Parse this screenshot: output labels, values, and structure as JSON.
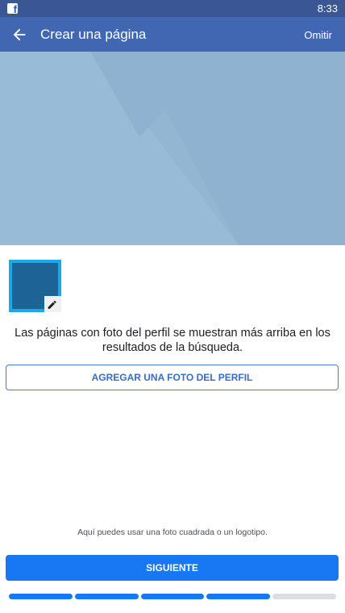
{
  "status_bar": {
    "app_icon": "facebook-icon",
    "time": "8:33"
  },
  "app_bar": {
    "back_icon": "arrow-left-icon",
    "title": "Crear una página",
    "skip_label": "Omitir"
  },
  "cover": {
    "background_color": "#93b6d3"
  },
  "profile": {
    "edit_icon": "pencil-icon",
    "info_text": "Las páginas con foto del perfil se muestran más arriba en los resultados de la búsqueda.",
    "add_photo_label": "AGREGAR UNA FOTO DEL PERFIL"
  },
  "footer": {
    "hint": "Aquí puedes usar una foto cuadrada o un logotipo.",
    "next_label": "SIGUIENTE"
  },
  "progress": {
    "total_steps": 5,
    "completed_steps": 4,
    "active_color": "#1877f2",
    "inactive_color": "#dadde1"
  },
  "colors": {
    "status_bar": "#3a5695",
    "app_bar": "#4267b2",
    "accent": "#1877f2"
  }
}
